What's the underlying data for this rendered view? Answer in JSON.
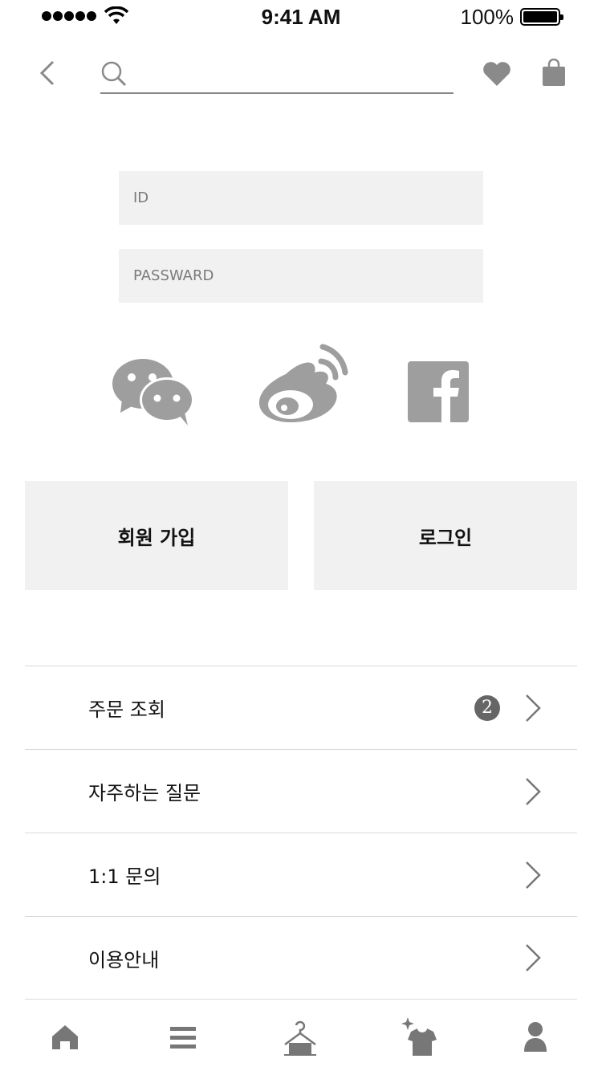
{
  "status_bar": {
    "time": "9:41 AM",
    "battery": "100%"
  },
  "header": {
    "search_placeholder": ""
  },
  "login": {
    "id_placeholder": "ID",
    "password_placeholder": "PASSWARD"
  },
  "social_icons": [
    "wechat-icon",
    "weibo-icon",
    "facebook-icon"
  ],
  "buttons": {
    "signup": "회원 가입",
    "login": "로그인"
  },
  "menu": {
    "items": [
      {
        "label": "주문 조회",
        "badge": "2"
      },
      {
        "label": "자주하는 질문"
      },
      {
        "label": "1:1 문의"
      },
      {
        "label": "이용안내"
      }
    ]
  },
  "tabbar": {
    "icons": [
      "home-icon",
      "list-icon",
      "hanger-icon",
      "tshirt-icon",
      "profile-icon"
    ]
  },
  "colors": {
    "icon_gray": "#8a8a8a",
    "field_bg": "#f1f1f1",
    "badge_bg": "#666666"
  }
}
